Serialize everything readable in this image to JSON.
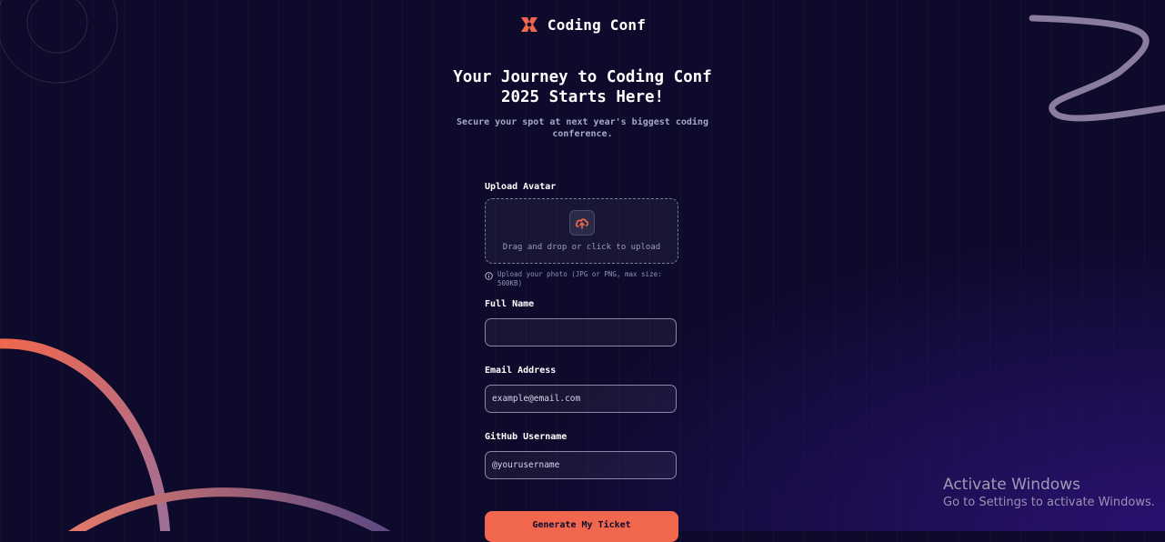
{
  "brand": {
    "name": "Coding Conf",
    "accent": "#f0674e"
  },
  "hero": {
    "title_line1": "Your Journey to Coding Conf",
    "title_line2": "2025 Starts Here!",
    "subtitle_line1": "Secure your spot at next year's biggest coding",
    "subtitle_line2": "conference."
  },
  "form": {
    "avatar": {
      "label": "Upload Avatar",
      "drop_text": "Drag and drop or click to upload",
      "hint_line1": "Upload your photo (JPG or PNG, max size:",
      "hint_line2": "500KB)",
      "icon": "cloud-upload-icon"
    },
    "full_name": {
      "label": "Full Name",
      "value": ""
    },
    "email": {
      "label": "Email Address",
      "value": "example@email.com"
    },
    "github": {
      "label": "GitHub Username",
      "value": "@yourusername"
    },
    "submit_label": "Generate My Ticket"
  },
  "watermark": {
    "title": "Activate Windows",
    "subtitle": "Go to Settings to activate Windows."
  }
}
